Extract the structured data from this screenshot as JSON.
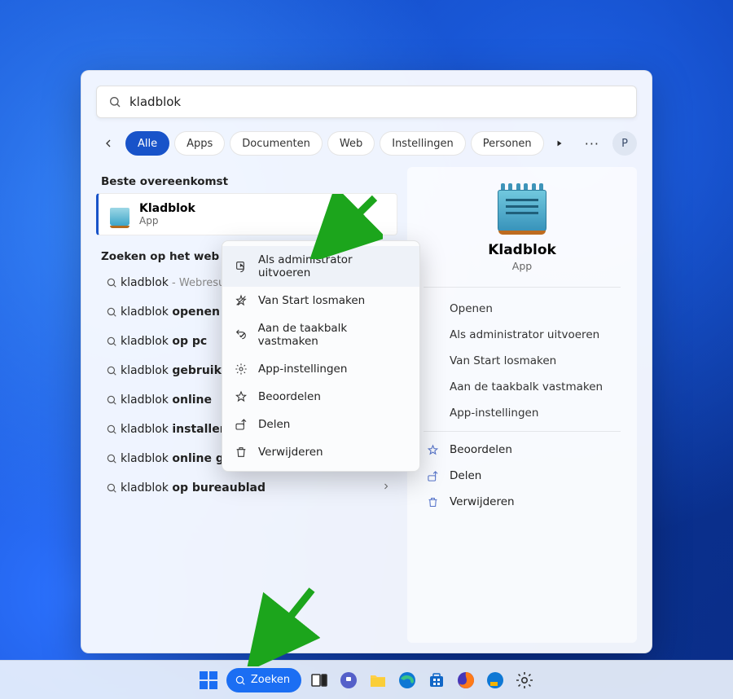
{
  "search": {
    "query": "kladblok"
  },
  "filters": {
    "all": "Alle",
    "apps": "Apps",
    "documents": "Documenten",
    "web": "Web",
    "settings": "Instellingen",
    "people": "Personen"
  },
  "avatar_initial": "P",
  "sections": {
    "best_match": "Beste overeenkomst",
    "web_search": "Zoeken op het web"
  },
  "best_match": {
    "title": "Kladblok",
    "subtitle": "App"
  },
  "web_results": [
    {
      "prefix": "kladblok",
      "bold": "",
      "suffix": " - Webresultaten bekijken"
    },
    {
      "prefix": "kladblok ",
      "bold": "openen",
      "suffix": ""
    },
    {
      "prefix": "kladblok ",
      "bold": "op pc",
      "suffix": ""
    },
    {
      "prefix": "kladblok ",
      "bold": "gebruiken",
      "suffix": ""
    },
    {
      "prefix": "kladblok ",
      "bold": "online",
      "suffix": ""
    },
    {
      "prefix": "kladblok ",
      "bold": "installeren",
      "suffix": ""
    },
    {
      "prefix": "kladblok ",
      "bold": "online gratis",
      "suffix": ""
    },
    {
      "prefix": "kladblok ",
      "bold": "op bureaublad",
      "suffix": ""
    }
  ],
  "context_menu": [
    "Als administrator uitvoeren",
    "Van Start losmaken",
    "Aan de taakbalk vastmaken",
    "App-instellingen",
    "Beoordelen",
    "Delen",
    "Verwijderen"
  ],
  "preview": {
    "title": "Kladblok",
    "subtitle": "App",
    "primary_actions": [
      "Openen",
      "Als administrator uitvoeren",
      "Van Start losmaken",
      "Aan de taakbalk vastmaken",
      "App-instellingen"
    ],
    "secondary_actions": [
      "Beoordelen",
      "Delen",
      "Verwijderen"
    ]
  },
  "taskbar": {
    "search_label": "Zoeken"
  }
}
